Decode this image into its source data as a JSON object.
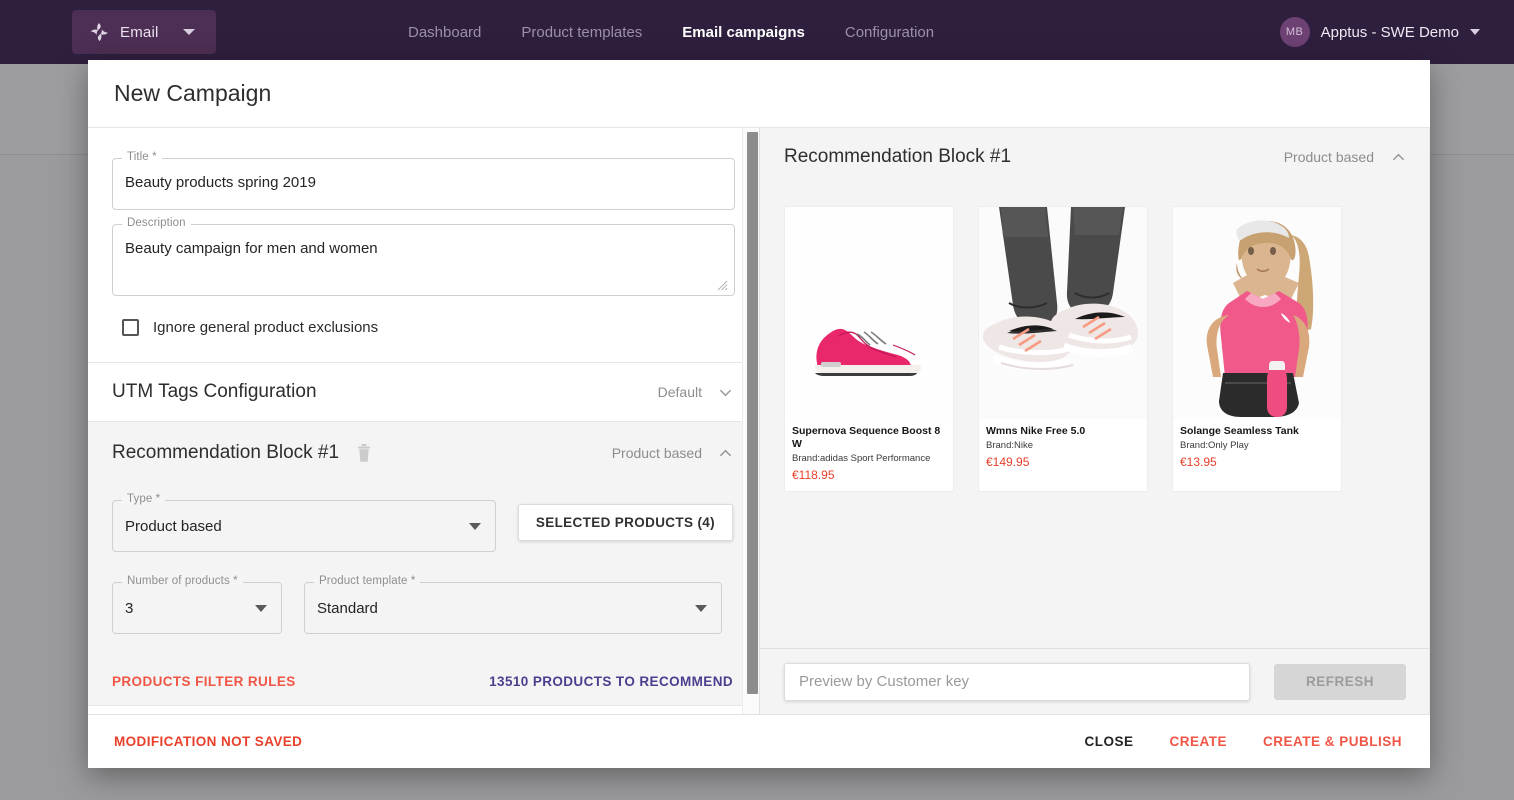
{
  "topnav": {
    "brand": {
      "icon": "pinwheel-logo-icon",
      "label": "Email",
      "caret": "chevron-down-icon"
    },
    "links": [
      {
        "label": "Dashboard",
        "active": false
      },
      {
        "label": "Product templates",
        "active": false
      },
      {
        "label": "Email campaigns",
        "active": true
      },
      {
        "label": "Configuration",
        "active": false
      }
    ],
    "account": {
      "initials": "MB",
      "name": "Apptus - SWE Demo",
      "caret": "chevron-down-icon"
    }
  },
  "dialog": {
    "title": "New Campaign",
    "fields": {
      "title": {
        "label": "Title *",
        "value": "Beauty products spring 2019"
      },
      "description": {
        "label": "Description",
        "value": "Beauty campaign for men and women"
      },
      "ignore_exclusions": {
        "label": "Ignore general product exclusions",
        "checked": false
      }
    },
    "utm": {
      "title": "UTM Tags Configuration",
      "value": "Default",
      "chevron": "chevron-down-icon"
    },
    "rec_block": {
      "title": "Recommendation Block #1",
      "delete_icon": "trash-icon",
      "badge": "Product based",
      "chevron": "chevron-up-icon",
      "type": {
        "label": "Type *",
        "value": "Product based"
      },
      "selected_products_button": "SELECTED PRODUCTS (4)",
      "number_of_products": {
        "label": "Number of products *",
        "value": "3"
      },
      "product_template": {
        "label": "Product template *",
        "value": "Standard"
      },
      "filter_rules_link": "PRODUCTS FILTER RULES",
      "products_to_recommend_link": "13510 PRODUCTS TO RECOMMEND"
    },
    "preview": {
      "title": "Recommendation Block #1",
      "badge": "Product based",
      "chevron": "chevron-up-icon",
      "products": [
        {
          "name": "Supernova Sequence Boost 8 W",
          "brand": "Brand:adidas Sport Performance",
          "price": "€118.95",
          "image": "pink-running-shoe"
        },
        {
          "name": "Wmns Nike Free 5.0",
          "brand": "Brand:Nike",
          "price": "€149.95",
          "image": "legs-wearing-nike-shoes"
        },
        {
          "name": "Solange Seamless Tank",
          "brand": "Brand:Only Play",
          "price": "€13.95",
          "image": "woman-in-pink-tank-top"
        }
      ],
      "customer_key_placeholder": "Preview by Customer key",
      "customer_key_value": "",
      "refresh_button": "REFRESH"
    },
    "footer": {
      "status": "MODIFICATION NOT SAVED",
      "close": "CLOSE",
      "create": "CREATE",
      "create_publish": "CREATE & PUBLISH"
    }
  },
  "colors": {
    "nav_bg": "#2f1f3f",
    "brand_btn": "#4d2e54",
    "accent_red": "#f05545",
    "price_red": "#e8402a",
    "link_blue": "#4a3f8f"
  }
}
